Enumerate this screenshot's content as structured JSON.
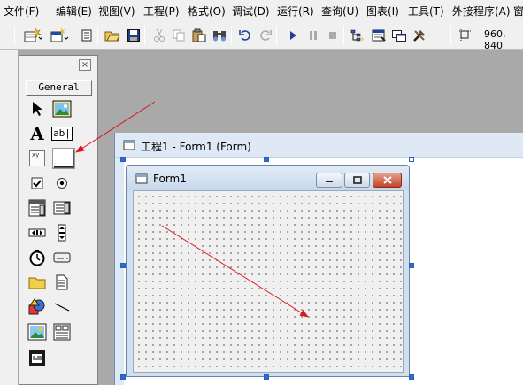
{
  "menu": [
    {
      "label": "文件(F)"
    },
    {
      "label": "编辑(E)"
    },
    {
      "label": "视图(V)"
    },
    {
      "label": "工程(P)"
    },
    {
      "label": "格式(O)"
    },
    {
      "label": "调试(D)"
    },
    {
      "label": "运行(R)"
    },
    {
      "label": "查询(U)"
    },
    {
      "label": "图表(I)"
    },
    {
      "label": "工具(T)"
    },
    {
      "label": "外接程序(A)"
    },
    {
      "label": "窗"
    }
  ],
  "toolbar": {
    "coords": "960, 840",
    "icons": [
      "add-project-icon",
      "add-form-icon",
      "menu-editor-icon",
      "open-project-icon",
      "save-project-icon",
      "cut-icon",
      "copy-icon",
      "paste-icon",
      "find-icon",
      "undo-icon",
      "redo-icon",
      "start-icon",
      "pause-icon",
      "stop-icon",
      "project-explorer-icon",
      "properties-window-icon",
      "form-layout-icon",
      "toolbox-icon",
      "position-icon"
    ]
  },
  "toolbox": {
    "tab_label": "General",
    "close_glyph": "×",
    "tools": [
      "pointer-icon",
      "picturebox-icon",
      "label-icon",
      "textbox-icon",
      "frame-icon",
      "commandbutton-icon",
      "checkbox-icon",
      "optionbutton-icon",
      "combobox-icon",
      "listbox-icon",
      "hscrollbar-icon",
      "vscrollbar-icon",
      "timer-icon",
      "drivelistbox-icon",
      "dirlistbox-icon",
      "filelistbox-icon",
      "shape-icon",
      "line-icon",
      "image-icon",
      "data-icon",
      "ole-icon"
    ],
    "textbox_glyph": "ab|",
    "label_glyph": "A",
    "frame_glyph": "xy"
  },
  "designer": {
    "title": "工程1 - Form1 (Form)"
  },
  "form": {
    "caption": "Form1"
  },
  "colors": {
    "annotation_arrow": "#e0141e",
    "selection_handle": "#2b6bd8",
    "form_close": "#c3442a"
  }
}
